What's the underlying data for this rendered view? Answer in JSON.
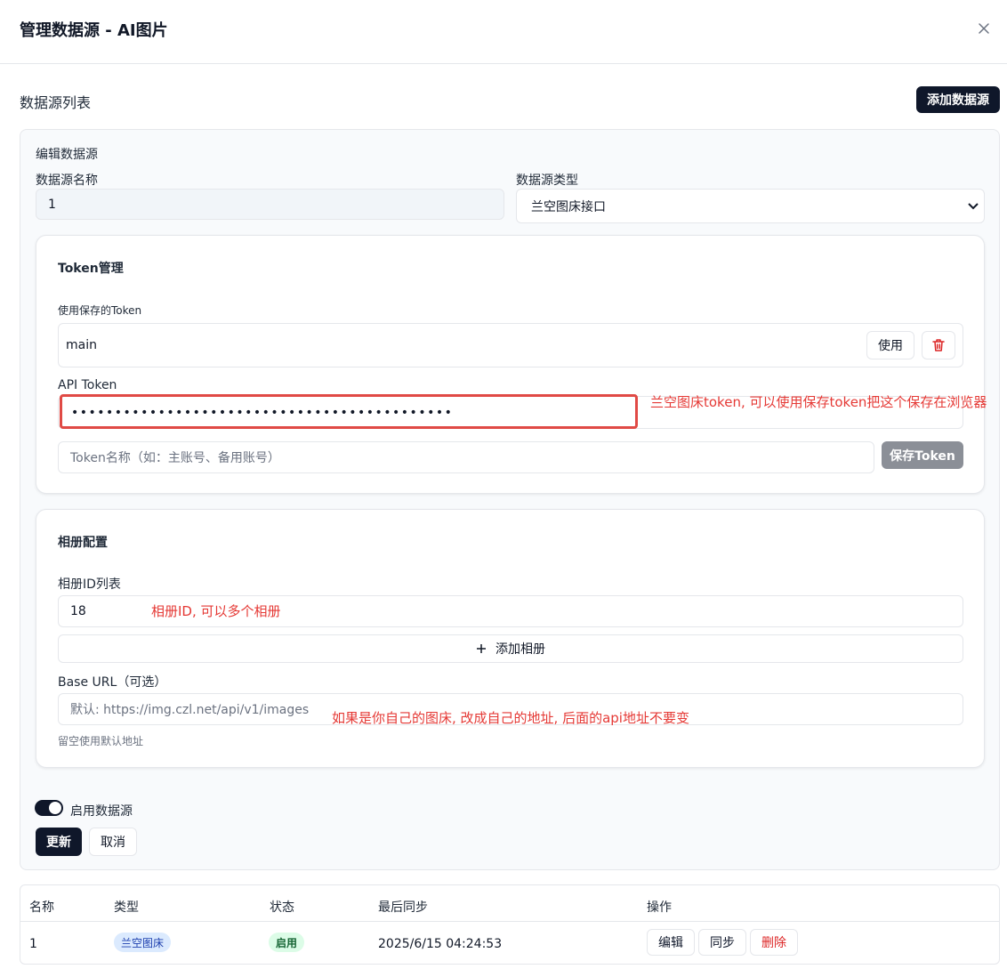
{
  "dialog": {
    "title": "管理数据源 - AI图片",
    "close_icon": "close-icon"
  },
  "list": {
    "title": "数据源列表",
    "add_button": "添加数据源"
  },
  "edit": {
    "title": "编辑数据源",
    "name_label": "数据源名称",
    "name_value": "1",
    "type_label": "数据源类型",
    "type_value": "兰空图床接口",
    "type_options": [
      "兰空图床接口"
    ]
  },
  "token": {
    "section_title": "Token管理",
    "saved_label": "使用保存的Token",
    "saved_name": "main",
    "use_button": "使用",
    "delete_icon": "trash-icon",
    "api_label": "API Token",
    "api_value": "••••••••••••••••••••••••••••••••••••••••••••",
    "name_placeholder": "Token名称（如：主账号、备用账号）",
    "save_button": "保存Token",
    "annotation": "兰空图床token, 可以使用保存token把这个保存在浏览器"
  },
  "album": {
    "section_title": "相册配置",
    "ids_label": "相册ID列表",
    "id_value": "18",
    "id_annotation": "相册ID, 可以多个相册",
    "add_button": "添加相册",
    "base_url_label": "Base URL（可选）",
    "base_url_placeholder": "默认: https://img.czl.net/api/v1/images",
    "base_url_annotation": "如果是你自己的图床, 改成自己的地址, 后面的api地址不要变",
    "base_url_hint": "留空使用默认地址"
  },
  "form": {
    "enable_label": "启用数据源",
    "enabled": true,
    "update_button": "更新",
    "cancel_button": "取消"
  },
  "table": {
    "headers": [
      "名称",
      "类型",
      "状态",
      "最后同步",
      "操作"
    ],
    "rows": [
      {
        "name": "1",
        "type": "兰空图床",
        "status": "启用",
        "last_sync": "2025/6/15 04:24:53",
        "actions": [
          "编辑",
          "同步",
          "删除"
        ]
      }
    ]
  },
  "colors": {
    "primary": "#0f172a",
    "danger": "#dc2626",
    "annotation": "#e53935"
  }
}
